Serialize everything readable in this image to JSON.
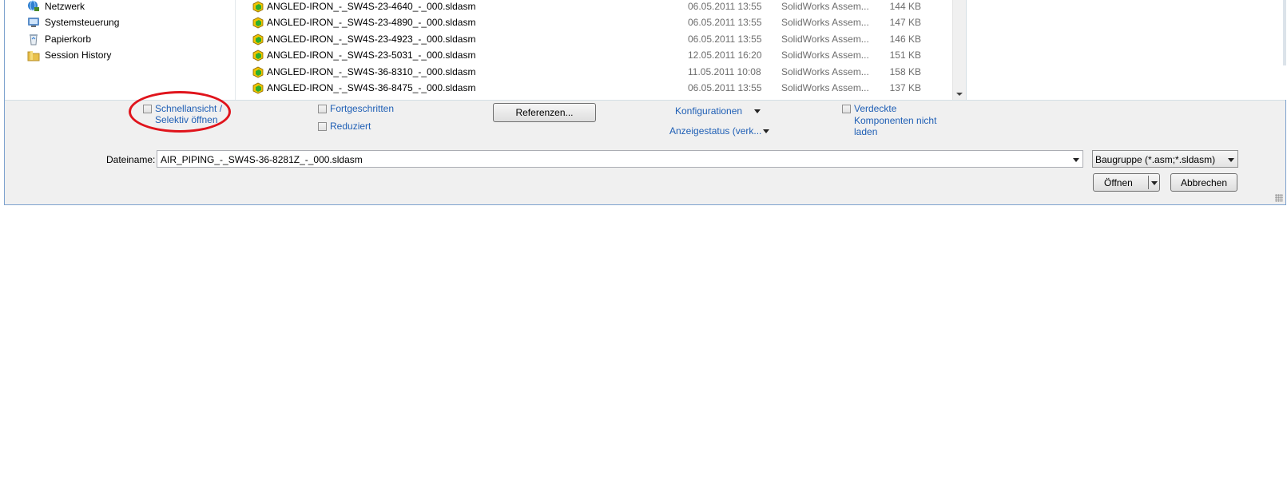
{
  "sidebar": {
    "items": [
      {
        "label": "Netzwerk",
        "icon": "network-icon"
      },
      {
        "label": "Systemsteuerung",
        "icon": "control-panel-icon"
      },
      {
        "label": "Papierkorb",
        "icon": "recycle-bin-icon"
      },
      {
        "label": "Session History",
        "icon": "folder-icon"
      }
    ]
  },
  "files": [
    {
      "name": "ANGLED-IRON_-_SW4S-23-4640_-_000.sldasm",
      "date": "06.05.2011 13:55",
      "type": "SolidWorks Assem...",
      "size": "144 KB"
    },
    {
      "name": "ANGLED-IRON_-_SW4S-23-4890_-_000.sldasm",
      "date": "06.05.2011 13:55",
      "type": "SolidWorks Assem...",
      "size": "147 KB"
    },
    {
      "name": "ANGLED-IRON_-_SW4S-23-4923_-_000.sldasm",
      "date": "06.05.2011 13:55",
      "type": "SolidWorks Assem...",
      "size": "146 KB"
    },
    {
      "name": "ANGLED-IRON_-_SW4S-23-5031_-_000.sldasm",
      "date": "12.05.2011 16:20",
      "type": "SolidWorks Assem...",
      "size": "151 KB"
    },
    {
      "name": "ANGLED-IRON_-_SW4S-36-8310_-_000.sldasm",
      "date": "11.05.2011 10:08",
      "type": "SolidWorks Assem...",
      "size": "158 KB"
    },
    {
      "name": "ANGLED-IRON_-_SW4S-36-8475_-_000.sldasm",
      "date": "06.05.2011 13:55",
      "type": "SolidWorks Assem...",
      "size": "137 KB"
    }
  ],
  "options": {
    "quickview_line1": "Schnellansicht /",
    "quickview_line2": "Selektiv öffnen",
    "advanced": "Fortgeschritten",
    "reduced": "Reduziert",
    "references_button": "Referenzen...",
    "configurations": "Konfigurationen",
    "display_state": "Anzeigestatus (verk...",
    "hidden_line1": "Verdeckte",
    "hidden_line2": "Komponenten nicht",
    "hidden_line3": "laden"
  },
  "filename": {
    "label": "Dateiname:",
    "value": "AIR_PIPING_-_SW4S-36-8281Z_-_000.sldasm"
  },
  "filetype": {
    "selected": "Baugruppe (*.asm;*.sldasm)"
  },
  "buttons": {
    "open": "Öffnen",
    "cancel": "Abbrechen"
  },
  "colors": {
    "link_blue": "#1f5fb5",
    "highlight_red": "#e0141c",
    "assembly_icon_yellow": "#f2c400",
    "assembly_icon_green": "#2fae2f"
  }
}
